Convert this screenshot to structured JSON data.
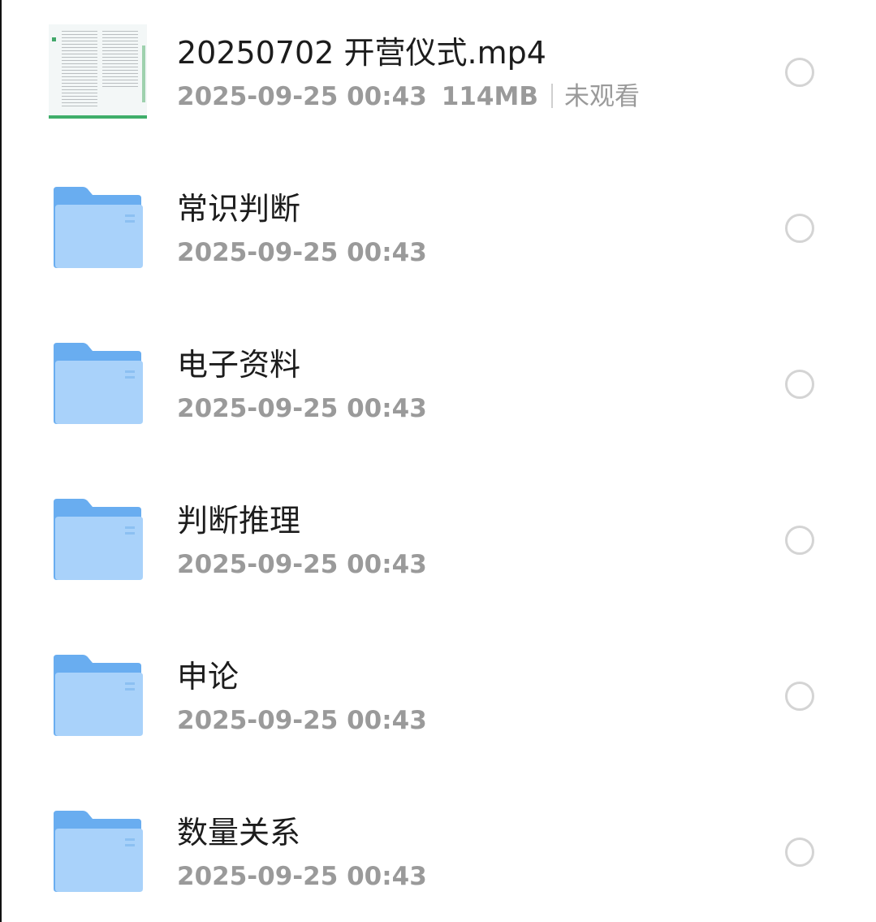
{
  "items": [
    {
      "type": "video",
      "name": "20250702 开营仪式.mp4",
      "date": "2025-09-25 00:43",
      "size": "114MB",
      "status": "未观看",
      "icon": "video-thumbnail"
    },
    {
      "type": "folder",
      "name": "常识判断",
      "date": "2025-09-25 00:43",
      "icon": "folder-icon"
    },
    {
      "type": "folder",
      "name": "电子资料",
      "date": "2025-09-25 00:43",
      "icon": "folder-icon"
    },
    {
      "type": "folder",
      "name": "判断推理",
      "date": "2025-09-25 00:43",
      "icon": "folder-icon"
    },
    {
      "type": "folder",
      "name": "申论",
      "date": "2025-09-25 00:43",
      "icon": "folder-icon"
    },
    {
      "type": "folder",
      "name": "数量关系",
      "date": "2025-09-25 00:43",
      "icon": "folder-icon"
    }
  ],
  "colors": {
    "folder": "#69adf0",
    "folder_front": "#a9d2fa",
    "title": "#1c1c1c",
    "meta": "#9a9a9a",
    "radio_border": "#d4d4d4"
  }
}
